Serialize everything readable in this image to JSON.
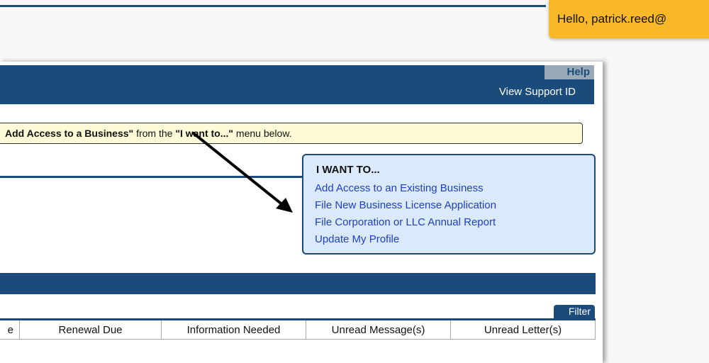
{
  "greeting": "Hello, patrick.reed@",
  "header": {
    "help_label": "Help",
    "support_link": "View Support ID"
  },
  "notice": {
    "part1": "Add Access to a Business\"",
    "part2": " from the ",
    "part3": "\"I want to...\"",
    "part4": " menu below."
  },
  "iwant": {
    "title": "I WANT TO...",
    "items": [
      "Add Access to an Existing Business",
      "File New Business License Application",
      "File Corporation or LLC Annual Report",
      "Update My Profile"
    ]
  },
  "table": {
    "filter_label": "Filter",
    "columns": [
      "e",
      "Renewal Due",
      "Information Needed",
      "Unread Message(s)",
      "Unread Letter(s)"
    ]
  },
  "colors": {
    "brand_blue": "#1a4b7a",
    "greeting_orange": "#f9b829",
    "notice_yellow": "#fdfbd7",
    "menu_bg": "#dae9fb",
    "link_blue": "#1f3fc4"
  }
}
